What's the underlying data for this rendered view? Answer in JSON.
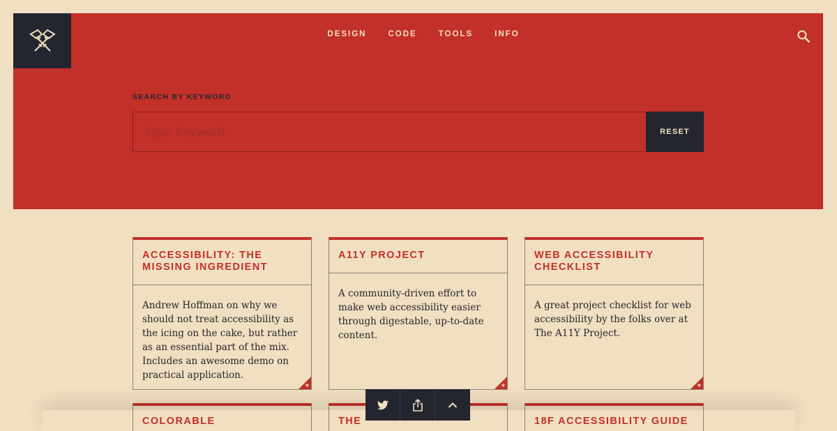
{
  "nav": {
    "items": [
      "DESIGN",
      "CODE",
      "TOOLS",
      "INFO"
    ]
  },
  "icons": {
    "logo": "crossed-axes-logo",
    "search": "search-icon",
    "twitter": "twitter-icon",
    "share": "share-icon",
    "up": "chevron-up-icon",
    "corner": "star-icon"
  },
  "search": {
    "label": "SEARCH BY KEYWORD",
    "placeholder": "Type Keyword",
    "value": "",
    "reset_label": "RESET"
  },
  "cards": [
    {
      "title": "ACCESSIBILITY: THE MISSING INGREDIENT",
      "body": "Andrew Hoffman on why we should not treat accessibility as the icing on the cake, but rather as an essential part of the mix. Includes an awesome demo on practical application."
    },
    {
      "title": "A11Y PROJECT",
      "body": "A community-driven effort to make web accessibility easier through digestable, up-to-date content."
    },
    {
      "title": "WEB ACCESSIBILITY CHECKLIST",
      "body": "A great project checklist for web accessibility by the folks over at The A11Y Project."
    }
  ],
  "cards_row2": [
    {
      "title": "COLORABLE"
    },
    {
      "title": "THE"
    },
    {
      "title": "18F ACCESSIBILITY GUIDE"
    }
  ],
  "colors": {
    "background": "#f1dfc1",
    "brand_red": "#c2302a",
    "dark": "#23262f"
  }
}
